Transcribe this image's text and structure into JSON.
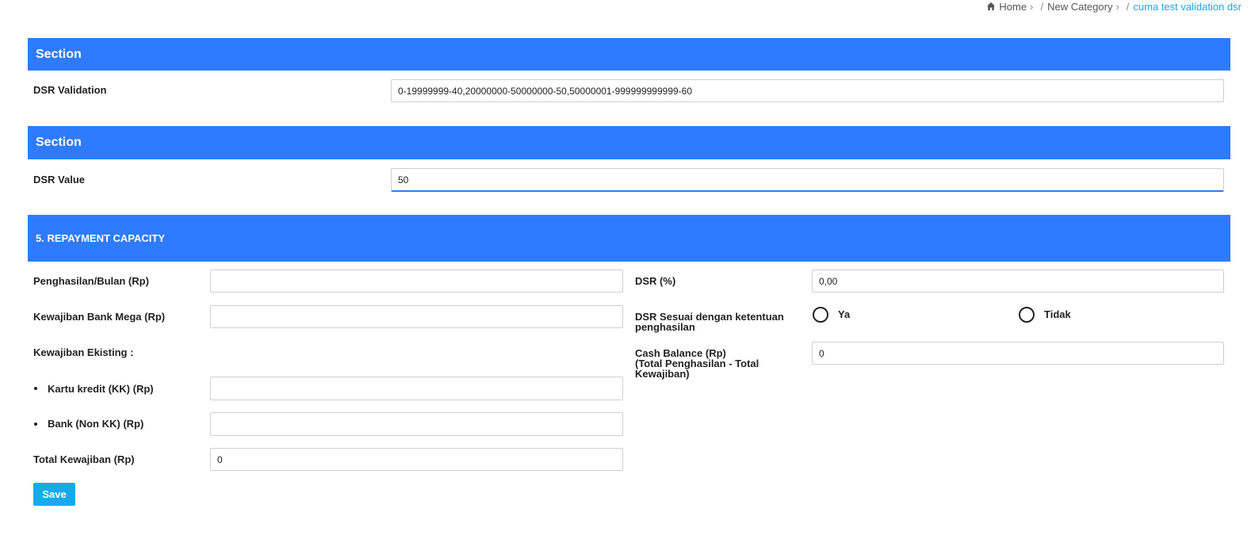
{
  "breadcrumb": {
    "home": "Home",
    "category": "New Category",
    "current": "cuma test validation dsr",
    "separator": "/",
    "chevron": "›",
    "home_icon": "home-icon"
  },
  "section1": {
    "title": "Section",
    "dsr_validation_label": "DSR Validation",
    "dsr_validation_value": "0-19999999-40,20000000-50000000-50,50000001-999999999999-60"
  },
  "section2": {
    "title": "Section",
    "dsr_value_label": "DSR Value",
    "dsr_value_value": "50"
  },
  "repayment": {
    "title": "5. REPAYMENT CAPACITY",
    "penghasilan_label": "Penghasilan/Bulan (Rp)",
    "penghasilan_value": "",
    "kewajiban_mega_label": "Kewajiban Bank Mega (Rp)",
    "kewajiban_mega_value": "",
    "kewajiban_eksisting_label": "Kewajiban Ekisting :",
    "kartu_kredit_label": "Kartu kredit (KK) (Rp)",
    "kartu_kredit_value": "",
    "bank_non_kk_label": "Bank (Non KK) (Rp)",
    "bank_non_kk_value": "",
    "total_kewajiban_label": "Total Kewajiban (Rp)",
    "total_kewajiban_value": "0",
    "dsr_percent_label": "DSR (%)",
    "dsr_percent_value": "0,00",
    "dsr_sesuai_label_line1": "DSR Sesuai dengan ketentuan",
    "dsr_sesuai_label_line2": "penghasilan",
    "option_ya": "Ya",
    "option_tidak": "Tidak",
    "cash_balance_label_line1": "Cash Balance (Rp)",
    "cash_balance_label_line2": "(Total Penghasilan - Total",
    "cash_balance_label_line3": "Kewajiban)",
    "cash_balance_value": "0"
  },
  "actions": {
    "save_label": "Save"
  },
  "colors": {
    "section_bar": "#2f7bff",
    "save_button": "#15a9f0",
    "breadcrumb_active": "#29a3e0"
  }
}
